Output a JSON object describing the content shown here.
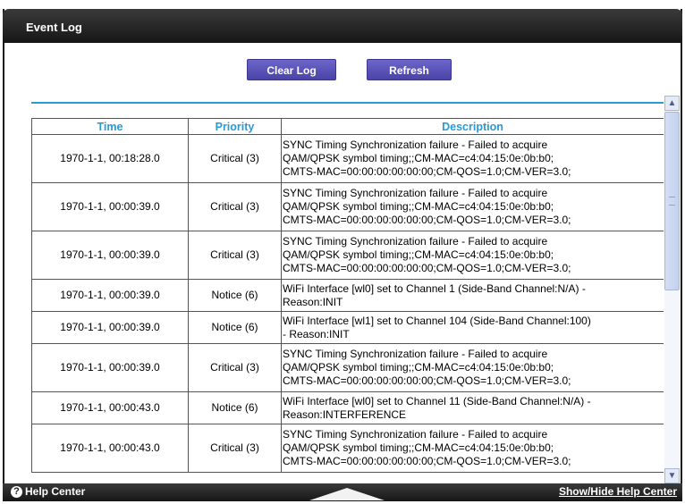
{
  "header": {
    "title": "Event Log"
  },
  "toolbar": {
    "clear_label": "Clear Log",
    "refresh_label": "Refresh"
  },
  "table": {
    "columns": [
      "Time",
      "Priority",
      "Description"
    ],
    "rows": [
      {
        "time": "1970-1-1, 00:18:28.0",
        "priority": "Critical (3)",
        "lines": [
          "SYNC Timing Synchronization failure - Failed to acquire",
          "QAM/QPSK symbol timing;;CM-MAC=c4:04:15:0e:0b:b0;",
          "CMTS-MAC=00:00:00:00:00:00;CM-QOS=1.0;CM-VER=3.0;"
        ]
      },
      {
        "time": "1970-1-1, 00:00:39.0",
        "priority": "Critical (3)",
        "lines": [
          "SYNC Timing Synchronization failure - Failed to acquire",
          "QAM/QPSK symbol timing;;CM-MAC=c4:04:15:0e:0b:b0;",
          "CMTS-MAC=00:00:00:00:00:00;CM-QOS=1.0;CM-VER=3.0;"
        ]
      },
      {
        "time": "1970-1-1, 00:00:39.0",
        "priority": "Critical (3)",
        "lines": [
          "SYNC Timing Synchronization failure - Failed to acquire",
          "QAM/QPSK symbol timing;;CM-MAC=c4:04:15:0e:0b:b0;",
          "CMTS-MAC=00:00:00:00:00:00;CM-QOS=1.0;CM-VER=3.0;"
        ]
      },
      {
        "time": "1970-1-1, 00:00:39.0",
        "priority": "Notice (6)",
        "lines": [
          "WiFi Interface [wl0] set to Channel 1 (Side-Band Channel:N/A) -",
          "Reason:INIT"
        ]
      },
      {
        "time": "1970-1-1, 00:00:39.0",
        "priority": "Notice (6)",
        "lines": [
          "WiFi Interface [wl1] set to Channel 104 (Side-Band Channel:100)",
          "- Reason:INIT"
        ]
      },
      {
        "time": "1970-1-1, 00:00:39.0",
        "priority": "Critical (3)",
        "lines": [
          "SYNC Timing Synchronization failure - Failed to acquire",
          "QAM/QPSK symbol timing;;CM-MAC=c4:04:15:0e:0b:b0;",
          "CMTS-MAC=00:00:00:00:00:00;CM-QOS=1.0;CM-VER=3.0;"
        ]
      },
      {
        "time": "1970-1-1, 00:00:43.0",
        "priority": "Notice (6)",
        "lines": [
          "WiFi Interface [wl0] set to Channel 11 (Side-Band Channel:N/A) -",
          "Reason:INTERFERENCE"
        ]
      },
      {
        "time": "1970-1-1, 00:00:43.0",
        "priority": "Critical (3)",
        "lines": [
          "SYNC Timing Synchronization failure - Failed to acquire",
          "QAM/QPSK symbol timing;;CM-MAC=c4:04:15:0e:0b:b0;",
          "CMTS-MAC=00:00:00:00:00:00;CM-QOS=1.0;CM-VER=3.0;"
        ]
      }
    ]
  },
  "footer": {
    "help_label": "Help Center",
    "show_hide_label": "Show/Hide Help Center"
  },
  "icons": {
    "help": "question-mark-circle-icon",
    "scroll_up": "arrow-up-icon",
    "scroll_down": "arrow-down-icon",
    "toggle": "triangle-up-icon"
  },
  "colors": {
    "accent": "#2a9ad6",
    "button": "#5a53b8",
    "bar": "#1f1f1f"
  }
}
